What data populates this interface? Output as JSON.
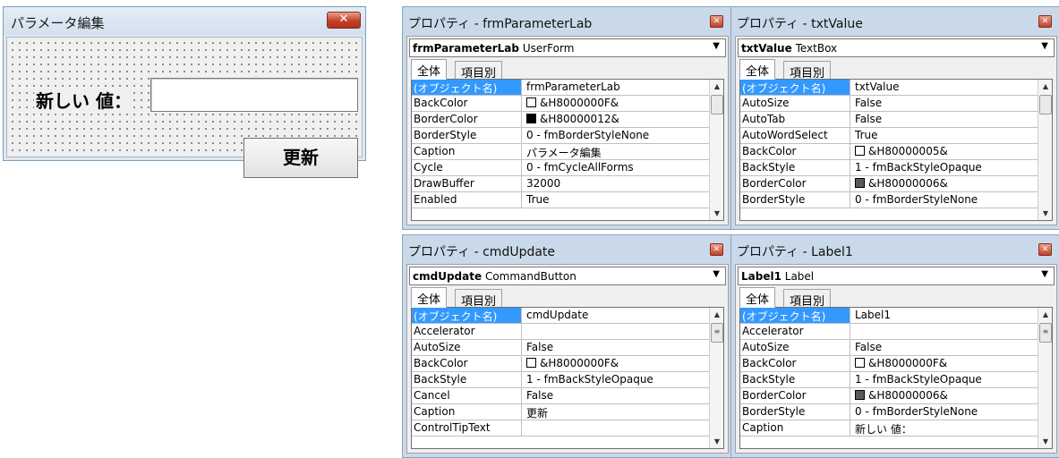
{
  "userform": {
    "title": "パラメータ編集",
    "label": "新しい 値：",
    "textbox_value": "",
    "button": "更新"
  },
  "panes": [
    {
      "title": "プロパティ - frmParameterLab",
      "object_name": "frmParameterLab",
      "object_type": "UserForm",
      "tab_all": "全体",
      "tab_category": "項目別",
      "rows": [
        {
          "name": "(オブジェクト名)",
          "value": "frmParameterLab",
          "selected": true
        },
        {
          "name": "BackColor",
          "value": "&H8000000F&",
          "swatch": "#ffffff"
        },
        {
          "name": "BorderColor",
          "value": "&H80000012&",
          "swatch": "#000000"
        },
        {
          "name": "BorderStyle",
          "value": "0 - fmBorderStyleNone"
        },
        {
          "name": "Caption",
          "value": "パラメータ編集"
        },
        {
          "name": "Cycle",
          "value": "0 - fmCycleAllForms"
        },
        {
          "name": "DrawBuffer",
          "value": "32000"
        },
        {
          "name": "Enabled",
          "value": "True"
        }
      ],
      "thumb": "plain"
    },
    {
      "title": "プロパティ - txtValue",
      "object_name": "txtValue",
      "object_type": "TextBox",
      "tab_all": "全体",
      "tab_category": "項目別",
      "rows": [
        {
          "name": "(オブジェクト名)",
          "value": "txtValue",
          "selected": true
        },
        {
          "name": "AutoSize",
          "value": "False"
        },
        {
          "name": "AutoTab",
          "value": "False"
        },
        {
          "name": "AutoWordSelect",
          "value": "True"
        },
        {
          "name": "BackColor",
          "value": "&H80000005&",
          "swatch": "#ffffff"
        },
        {
          "name": "BackStyle",
          "value": "1 - fmBackStyleOpaque"
        },
        {
          "name": "BorderColor",
          "value": "&H80000006&",
          "swatch": "#5a5a5a"
        },
        {
          "name": "BorderStyle",
          "value": "0 - fmBorderStyleNone"
        }
      ],
      "thumb": "plain"
    },
    {
      "title": "プロパティ - cmdUpdate",
      "object_name": "cmdUpdate",
      "object_type": "CommandButton",
      "tab_all": "全体",
      "tab_category": "項目別",
      "rows": [
        {
          "name": "(オブジェクト名)",
          "value": "cmdUpdate",
          "selected": true
        },
        {
          "name": "Accelerator",
          "value": ""
        },
        {
          "name": "AutoSize",
          "value": "False"
        },
        {
          "name": "BackColor",
          "value": "&H8000000F&",
          "swatch": "#ffffff"
        },
        {
          "name": "BackStyle",
          "value": "1 - fmBackStyleOpaque"
        },
        {
          "name": "Cancel",
          "value": "False"
        },
        {
          "name": "Caption",
          "value": "更新"
        },
        {
          "name": "ControlTipText",
          "value": ""
        }
      ],
      "thumb": "grip"
    },
    {
      "title": "プロパティ - Label1",
      "object_name": "Label1",
      "object_type": "Label",
      "tab_all": "全体",
      "tab_category": "項目別",
      "rows": [
        {
          "name": "(オブジェクト名)",
          "value": "Label1",
          "selected": true
        },
        {
          "name": "Accelerator",
          "value": ""
        },
        {
          "name": "AutoSize",
          "value": "False"
        },
        {
          "name": "BackColor",
          "value": "&H8000000F&",
          "swatch": "#ffffff"
        },
        {
          "name": "BackStyle",
          "value": "1 - fmBackStyleOpaque"
        },
        {
          "name": "BorderColor",
          "value": "&H80000006&",
          "swatch": "#5a5a5a"
        },
        {
          "name": "BorderStyle",
          "value": "0 - fmBorderStyleNone"
        },
        {
          "name": "Caption",
          "value": "新しい 値："
        }
      ],
      "thumb": "grip"
    }
  ]
}
